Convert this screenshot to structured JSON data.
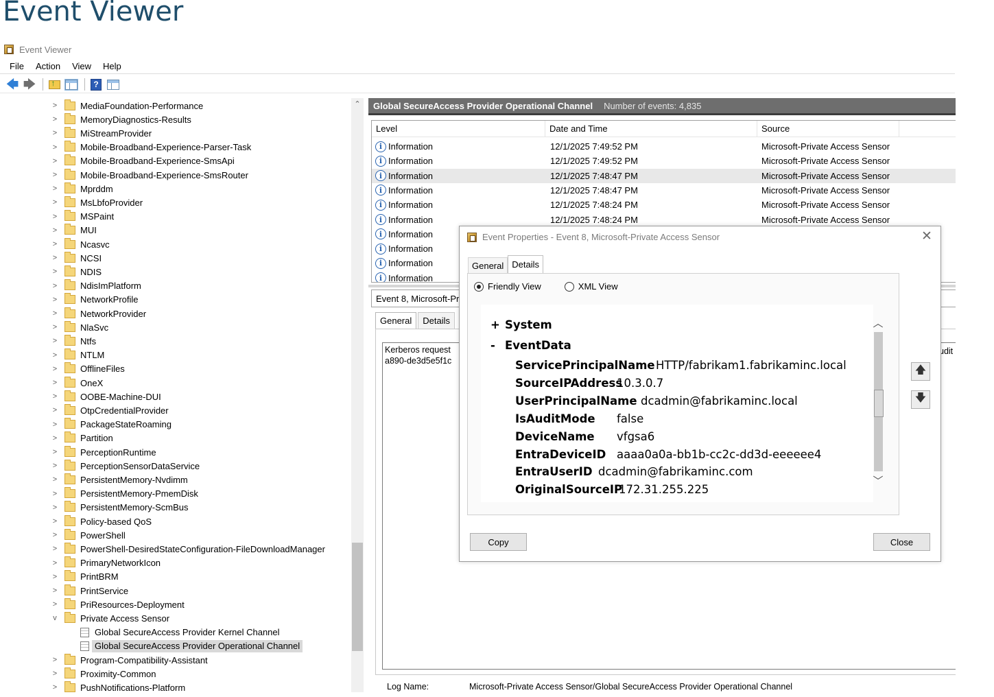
{
  "page_heading": "Event Viewer",
  "window": {
    "title": "Event Viewer"
  },
  "menu": [
    "File",
    "Action",
    "View",
    "Help"
  ],
  "toolbar": {
    "icons": [
      "back-arrow-icon",
      "forward-arrow-icon",
      "up-folder-icon",
      "show-hide-tree-icon",
      "help-icon",
      "action-pane-icon"
    ]
  },
  "tree": {
    "items": [
      {
        "label": "MediaFoundation-Performance",
        "expander": ">"
      },
      {
        "label": "MemoryDiagnostics-Results",
        "expander": ">"
      },
      {
        "label": "MiStreamProvider",
        "expander": ">"
      },
      {
        "label": "Mobile-Broadband-Experience-Parser-Task",
        "expander": ">"
      },
      {
        "label": "Mobile-Broadband-Experience-SmsApi",
        "expander": ">"
      },
      {
        "label": "Mobile-Broadband-Experience-SmsRouter",
        "expander": ">"
      },
      {
        "label": "Mprddm",
        "expander": ">"
      },
      {
        "label": "MsLbfoProvider",
        "expander": ">"
      },
      {
        "label": "MSPaint",
        "expander": ">"
      },
      {
        "label": "MUI",
        "expander": ">"
      },
      {
        "label": "Ncasvc",
        "expander": ">"
      },
      {
        "label": "NCSI",
        "expander": ">"
      },
      {
        "label": "NDIS",
        "expander": ">"
      },
      {
        "label": "NdisImPlatform",
        "expander": ">"
      },
      {
        "label": "NetworkProfile",
        "expander": ">"
      },
      {
        "label": "NetworkProvider",
        "expander": ">"
      },
      {
        "label": "NlaSvc",
        "expander": ">"
      },
      {
        "label": "Ntfs",
        "expander": ">"
      },
      {
        "label": "NTLM",
        "expander": ">"
      },
      {
        "label": "OfflineFiles",
        "expander": ">"
      },
      {
        "label": "OneX",
        "expander": ">"
      },
      {
        "label": "OOBE-Machine-DUI",
        "expander": ">"
      },
      {
        "label": "OtpCredentialProvider",
        "expander": ">"
      },
      {
        "label": "PackageStateRoaming",
        "expander": ">"
      },
      {
        "label": "Partition",
        "expander": ">"
      },
      {
        "label": "PerceptionRuntime",
        "expander": ">"
      },
      {
        "label": "PerceptionSensorDataService",
        "expander": ">"
      },
      {
        "label": "PersistentMemory-Nvdimm",
        "expander": ">"
      },
      {
        "label": "PersistentMemory-PmemDisk",
        "expander": ">"
      },
      {
        "label": "PersistentMemory-ScmBus",
        "expander": ">"
      },
      {
        "label": "Policy-based QoS",
        "expander": ">"
      },
      {
        "label": "PowerShell",
        "expander": ">"
      },
      {
        "label": "PowerShell-DesiredStateConfiguration-FileDownloadManager",
        "expander": ">"
      },
      {
        "label": "PrimaryNetworkIcon",
        "expander": ">"
      },
      {
        "label": "PrintBRM",
        "expander": ">"
      },
      {
        "label": "PrintService",
        "expander": ">"
      },
      {
        "label": "PriResources-Deployment",
        "expander": ">"
      },
      {
        "label": "Private Access Sensor",
        "expander": "v"
      },
      {
        "label": "Global SecureAccess Provider Kernel Channel",
        "child": true
      },
      {
        "label": "Global SecureAccess Provider Operational Channel",
        "child": true,
        "selected": true
      },
      {
        "label": "Program-Compatibility-Assistant",
        "expander": ">"
      },
      {
        "label": "Proximity-Common",
        "expander": ">"
      },
      {
        "label": "PushNotifications-Platform",
        "expander": ">"
      }
    ]
  },
  "events_pane": {
    "title": "Global SecureAccess Provider Operational Channel",
    "count_label": "Number of events: 4,835",
    "columns": [
      "Level",
      "Date and Time",
      "Source"
    ],
    "rows": [
      {
        "level": "Information",
        "date": "12/1/2025 7:49:52 PM",
        "source": "Microsoft-Private Access Sensor"
      },
      {
        "level": "Information",
        "date": "12/1/2025 7:49:52 PM",
        "source": "Microsoft-Private Access Sensor"
      },
      {
        "level": "Information",
        "date": "12/1/2025 7:48:47 PM",
        "source": "Microsoft-Private Access Sensor",
        "selected": true
      },
      {
        "level": "Information",
        "date": "12/1/2025 7:48:47 PM",
        "source": "Microsoft-Private Access Sensor"
      },
      {
        "level": "Information",
        "date": "12/1/2025 7:48:24 PM",
        "source": "Microsoft-Private Access Sensor"
      },
      {
        "level": "Information",
        "date": "12/1/2025 7:48:24 PM",
        "source": "Microsoft-Private Access Sensor"
      },
      {
        "level": "Information",
        "date": "",
        "source": ""
      },
      {
        "level": "Information",
        "date": "",
        "source": ""
      },
      {
        "level": "Information",
        "date": "",
        "source": ""
      },
      {
        "level": "Information",
        "date": "",
        "source": ""
      }
    ]
  },
  "preview": {
    "title": "Event 8, Microsoft-Pr",
    "tabs": [
      "General",
      "Details"
    ],
    "description_lines": [
      "Kerberos request",
      "a890-de3d5e5f1c"
    ],
    "right_fragment": "udit",
    "log_name_label": "Log Name:",
    "log_name_value": "Microsoft-Private Access Sensor/Global SecureAccess Provider Operational Channel"
  },
  "dialog": {
    "title": "Event Properties - Event 8, Microsoft-Private Access Sensor",
    "close_glyph": "✕",
    "tabs": [
      "General",
      "Details"
    ],
    "active_tab": "Details",
    "view_options": [
      "Friendly View",
      "XML View"
    ],
    "selected_view": "Friendly View",
    "sections": [
      {
        "toggle": "+",
        "name": "System"
      },
      {
        "toggle": "-",
        "name": "EventData"
      }
    ],
    "fields": [
      {
        "key": "ServicePrincipalName",
        "value": "HTTP/fabrikam1.fabrikaminc.local"
      },
      {
        "key": "SourceIPAddress",
        "value": "10.3.0.7"
      },
      {
        "key": "UserPrincipalName",
        "value": "dcadmin@fabrikaminc.local"
      },
      {
        "key": "IsAuditMode",
        "value": "false"
      },
      {
        "key": "DeviceName",
        "value": "vfgsa6"
      },
      {
        "key": "EntraDeviceID",
        "value": "aaaa0a0a-bb1b-cc2c-dd3d-eeeeee4"
      },
      {
        "key": "EntraUserID",
        "value": "dcadmin@fabrikaminc.com"
      },
      {
        "key": "OriginalSourceIP",
        "value": "172.31.255.225"
      }
    ],
    "nav_up_glyph": "🡅",
    "nav_down_glyph": "🡇",
    "copy_label": "Copy",
    "close_label": "Close"
  }
}
